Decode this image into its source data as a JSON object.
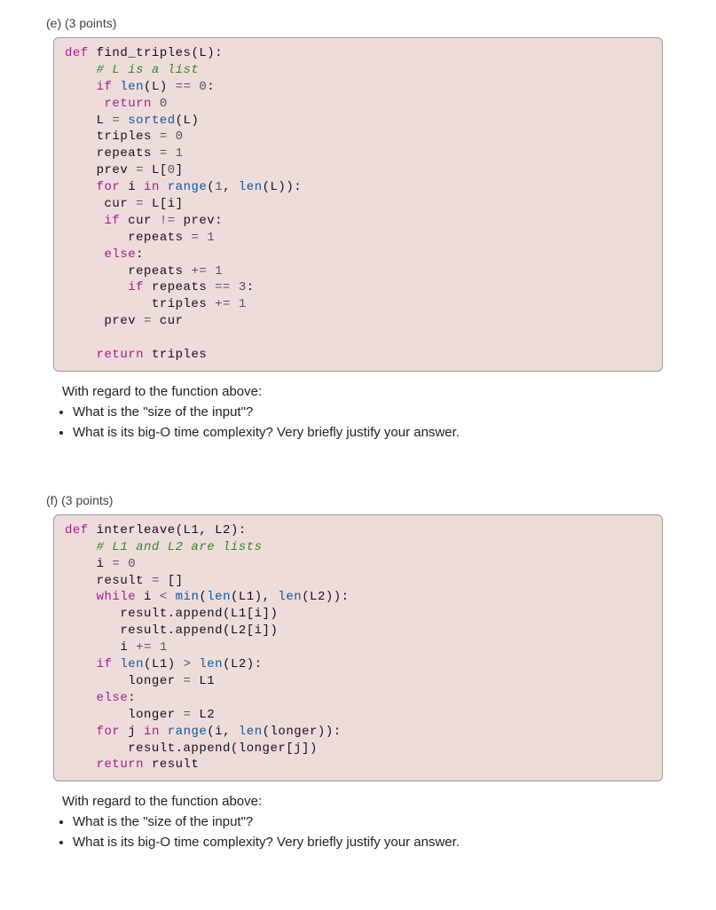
{
  "problems": [
    {
      "label": "(e)",
      "points": "(3 points)",
      "code_html": "<span class='kw'>def</span> <span class='de'>find_triples</span><span class='nm'>(L):</span>\n    <span class='cm'># L is a list</span>\n    <span class='kw'>if</span> <span class='fn'>len</span><span class='nm'>(L)</span> <span class='op'>==</span> <span class='nu'>0</span><span class='nm'>:</span>\n     <span class='kw'>return</span> <span class='nu'>0</span>\n    <span class='nm'>L</span> <span class='op'>=</span> <span class='fn'>sorted</span><span class='nm'>(L)</span>\n    <span class='nm'>triples</span> <span class='op'>=</span> <span class='nu'>0</span>\n    <span class='nm'>repeats</span> <span class='op'>=</span> <span class='nu'>1</span>\n    <span class='nm'>prev</span> <span class='op'>=</span> <span class='nm'>L[</span><span class='nu'>0</span><span class='nm'>]</span>\n    <span class='kw'>for</span> <span class='nm'>i</span> <span class='kw'>in</span> <span class='fn'>range</span><span class='nm'>(</span><span class='nu'>1</span><span class='nm'>,</span> <span class='fn'>len</span><span class='nm'>(L)):</span>\n     <span class='nm'>cur</span> <span class='op'>=</span> <span class='nm'>L[i]</span>\n     <span class='kw'>if</span> <span class='nm'>cur</span> <span class='op'>!=</span> <span class='nm'>prev:</span>\n        <span class='nm'>repeats</span> <span class='op'>=</span> <span class='nu'>1</span>\n     <span class='kw'>else</span><span class='nm'>:</span>\n        <span class='nm'>repeats</span> <span class='op'>+=</span> <span class='nu'>1</span>\n        <span class='kw'>if</span> <span class='nm'>repeats</span> <span class='op'>==</span> <span class='nu'>3</span><span class='nm'>:</span>\n           <span class='nm'>triples</span> <span class='op'>+=</span> <span class='nu'>1</span>\n     <span class='nm'>prev</span> <span class='op'>=</span> <span class='nm'>cur</span>\n\n    <span class='kw'>return</span> <span class='nm'>triples</span>",
      "prompt": "With regard to the function above:",
      "bullets": [
        "What is the \"size of the input\"?",
        "What is its big-O time complexity? Very briefly justify your answer."
      ]
    },
    {
      "label": "(f)",
      "points": "(3 points)",
      "code_html": "<span class='kw'>def</span> <span class='de'>interleave</span><span class='nm'>(L1, L2):</span>\n    <span class='cm'># L1 and L2 are lists</span>\n    <span class='nm'>i</span> <span class='op'>=</span> <span class='nu'>0</span>\n    <span class='nm'>result</span> <span class='op'>=</span> <span class='nm'>[]</span>\n    <span class='kw'>while</span> <span class='nm'>i</span> <span class='op'>&lt;</span> <span class='fn'>min</span><span class='nm'>(</span><span class='fn'>len</span><span class='nm'>(L1),</span> <span class='fn'>len</span><span class='nm'>(L2)):</span>\n       <span class='nm'>result.append(L1[i])</span>\n       <span class='nm'>result.append(L2[i])</span>\n       <span class='nm'>i</span> <span class='op'>+=</span> <span class='nu'>1</span>\n    <span class='kw'>if</span> <span class='fn'>len</span><span class='nm'>(L1)</span> <span class='op'>&gt;</span> <span class='fn'>len</span><span class='nm'>(L2):</span>\n        <span class='nm'>longer</span> <span class='op'>=</span> <span class='nm'>L1</span>\n    <span class='kw'>else</span><span class='nm'>:</span>\n        <span class='nm'>longer</span> <span class='op'>=</span> <span class='nm'>L2</span>\n    <span class='kw'>for</span> <span class='nm'>j</span> <span class='kw'>in</span> <span class='fn'>range</span><span class='nm'>(i,</span> <span class='fn'>len</span><span class='nm'>(longer)):</span>\n        <span class='nm'>result.append(longer[j])</span>\n    <span class='kw'>return</span> <span class='nm'>result</span>",
      "prompt": "With regard to the function above:",
      "bullets": [
        "What is the \"size of the input\"?",
        "What is its big-O time complexity? Very briefly justify your answer."
      ]
    }
  ]
}
